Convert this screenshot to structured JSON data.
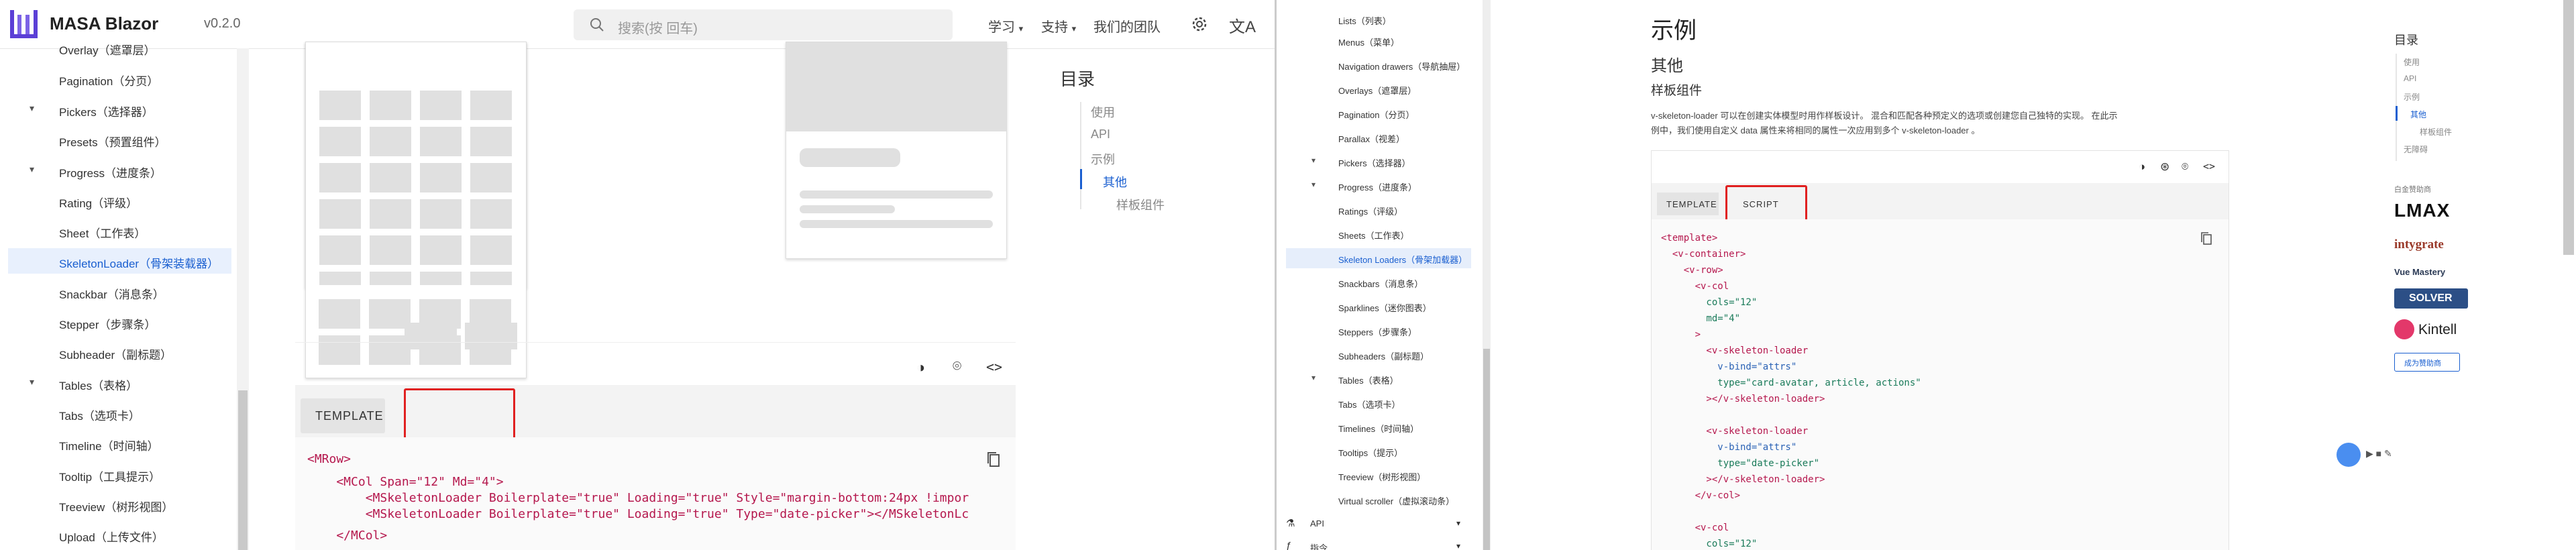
{
  "left": {
    "header": {
      "brand": "MASA Blazor",
      "version": "v0.2.0",
      "search_placeholder": "搜索(按 回车)",
      "nav": [
        "学习",
        "支持",
        "我们的团队"
      ]
    },
    "sidebar": [
      {
        "label": "Overlay（遮罩层）",
        "chev": ""
      },
      {
        "label": "Pagination（分页）",
        "chev": ""
      },
      {
        "label": "Pickers（选择器）",
        "chev": "▾"
      },
      {
        "label": "Presets（预置组件）",
        "chev": ""
      },
      {
        "label": "Progress（进度条）",
        "chev": "▾"
      },
      {
        "label": "Rating（评级）",
        "chev": ""
      },
      {
        "label": "Sheet（工作表）",
        "chev": ""
      },
      {
        "label": "SkeletonLoader（骨架装载器）",
        "chev": "",
        "active": true
      },
      {
        "label": "Snackbar（消息条）",
        "chev": ""
      },
      {
        "label": "Stepper（步骤条）",
        "chev": ""
      },
      {
        "label": "Subheader（副标题）",
        "chev": ""
      },
      {
        "label": "Tables（表格）",
        "chev": "▾"
      },
      {
        "label": "Tabs（选项卡）",
        "chev": ""
      },
      {
        "label": "Timeline（时间轴）",
        "chev": ""
      },
      {
        "label": "Tooltip（工具提示）",
        "chev": ""
      },
      {
        "label": "Treeview（树形视图）",
        "chev": ""
      },
      {
        "label": "Upload（上传文件）",
        "chev": ""
      }
    ],
    "tabs": {
      "template": "TEMPLATE"
    },
    "code": [
      "<MRow>",
      "    <MCol Span=\"12\" Md=\"4\">",
      "        <MSkeletonLoader Boilerplate=\"true\" Loading=\"true\" Style=\"margin-bottom:24px !impor",
      "        <MSkeletonLoader Boilerplate=\"true\" Loading=\"true\" Type=\"date-picker\"></MSkeletonLc",
      "    </MCol>"
    ],
    "toc": {
      "title": "目录",
      "items": [
        "使用",
        "API",
        "示例",
        "其他",
        "样板组件"
      ],
      "active": "其他"
    }
  },
  "right": {
    "sidebar": [
      {
        "label": "Lists（列表）",
        "chev": ""
      },
      {
        "label": "Menus（菜单）",
        "chev": ""
      },
      {
        "label": "Navigation drawers（导航抽屉）",
        "chev": ""
      },
      {
        "label": "Overlays（遮罩层）",
        "chev": ""
      },
      {
        "label": "Pagination（分页）",
        "chev": ""
      },
      {
        "label": "Parallax（视差）",
        "chev": ""
      },
      {
        "label": "Pickers（选择器）",
        "chev": "▾"
      },
      {
        "label": "Progress（进度条）",
        "chev": "▾"
      },
      {
        "label": "Ratings（评级）",
        "chev": ""
      },
      {
        "label": "Sheets（工作表）",
        "chev": ""
      },
      {
        "label": "Skeleton Loaders（骨架加载器）",
        "chev": "",
        "active": true
      },
      {
        "label": "Snackbars（消息条）",
        "chev": ""
      },
      {
        "label": "Sparklines（迷你图表）",
        "chev": ""
      },
      {
        "label": "Steppers（步骤条）",
        "chev": ""
      },
      {
        "label": "Subheaders（副标题）",
        "chev": ""
      },
      {
        "label": "Tables（表格）",
        "chev": "▾"
      },
      {
        "label": "Tabs（选项卡）",
        "chev": ""
      },
      {
        "label": "Timelines（时间轴）",
        "chev": ""
      },
      {
        "label": "Tooltips（提示）",
        "chev": ""
      },
      {
        "label": "Treeview（树形视图）",
        "chev": ""
      },
      {
        "label": "Virtual scroller（虚拟滚动条）",
        "chev": ""
      },
      {
        "label": "API",
        "chev": "▾"
      },
      {
        "label": "指令",
        "chev": "▾"
      }
    ],
    "content": {
      "heading": "示例",
      "sub": "其他",
      "subsub": "样板组件",
      "desc1": "v-skeleton-loader 可以在创建实体模型时用作样板设计。 混合和匹配各种预定义的选项或创建您自己独特的实现。 在此示",
      "desc2": "例中，我们使用自定义 data 属性来将相同的属性一次应用到多个 v-skeleton-loader 。",
      "tabs": [
        "TEMPLATE",
        "SCRIPT"
      ]
    },
    "code": [
      "<template>",
      "  <v-container>",
      "    <v-row>",
      "      <v-col",
      "        cols=\"12\"",
      "        md=\"4\"",
      "      >",
      "        <v-skeleton-loader",
      "          v-bind=\"attrs\"",
      "          type=\"card-avatar, article, actions\"",
      "        ></v-skeleton-loader>",
      "",
      "        <v-skeleton-loader",
      "          v-bind=\"attrs\"",
      "          type=\"date-picker\"",
      "        ></v-skeleton-loader>",
      "      </v-col>",
      "",
      "      <v-col",
      "        cols=\"12\""
    ],
    "toc": {
      "title": "目录",
      "items": [
        "使用",
        "API",
        "示例",
        "其他",
        "样板组件",
        "无障碍"
      ],
      "active": "其他"
    },
    "sponsors": {
      "title": "白金赞助商",
      "names": [
        "LMAX",
        "intygrate",
        "Vue Mastery",
        "SOLVER",
        "Kintell"
      ],
      "button": "成为赞助商"
    }
  }
}
